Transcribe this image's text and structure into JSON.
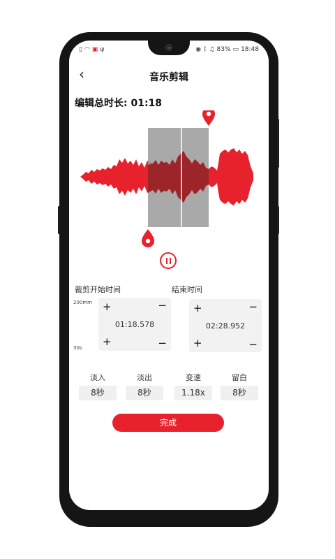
{
  "status_bar": {
    "left_icons": [
      "sim-icon",
      "wifi-icon",
      "app-notification-icon",
      "usb-icon"
    ],
    "battery_percent": "83%",
    "time": "18:48"
  },
  "appbar": {
    "title": "音乐剪辑"
  },
  "total_duration": "编辑总时长: 01:18",
  "trim": {
    "start_label": "裁剪开始时间",
    "end_label": "结束时间",
    "scale_top": "200mm",
    "scale_bottom": "30s",
    "plus": "+",
    "minus": "−",
    "start_time": "01:18.578",
    "end_time": "02:28.952"
  },
  "options": [
    {
      "label": "淡入",
      "value": "8秒"
    },
    {
      "label": "淡出",
      "value": "8秒"
    },
    {
      "label": "变速",
      "value": "1.18x"
    },
    {
      "label": "留白",
      "value": "8秒"
    }
  ],
  "done_label": "完成",
  "colors": {
    "accent": "#e8222c",
    "selection": "#9a9a9a"
  }
}
